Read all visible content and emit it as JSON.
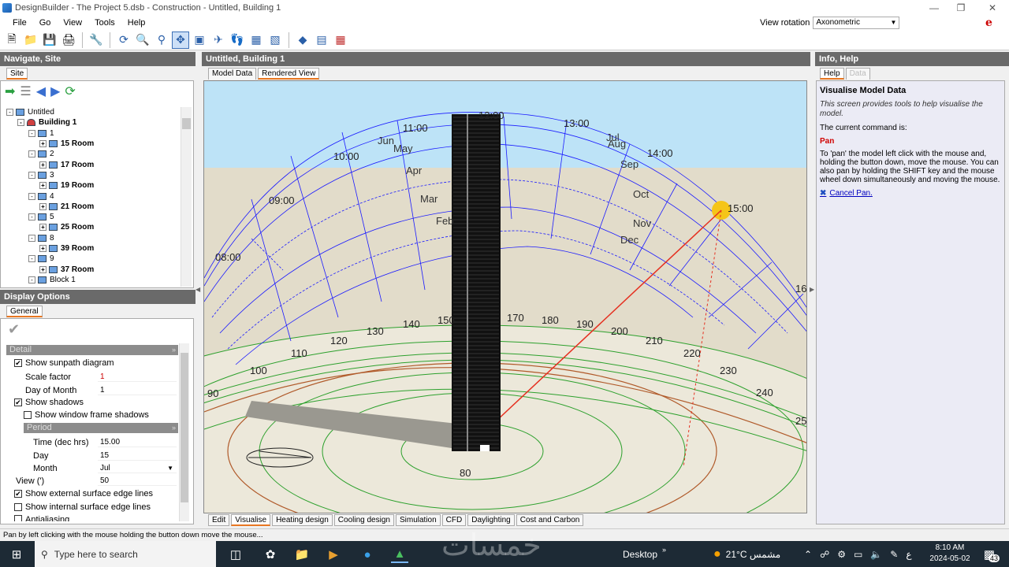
{
  "app": {
    "title": "DesignBuilder - The Project 5.dsb - Construction - Untitled, Building 1"
  },
  "menu": [
    "File",
    "Go",
    "View",
    "Tools",
    "Help"
  ],
  "view_rotation": {
    "label": "View rotation",
    "value": "Axonometric"
  },
  "left_panel": {
    "title": "Navigate, Site",
    "tab": "Site",
    "tree": [
      {
        "label": "Untitled",
        "level": 0,
        "bold": false,
        "icon": "site-icon"
      },
      {
        "label": "Building 1",
        "level": 1,
        "bold": true,
        "icon": "building-icon"
      },
      {
        "label": "1",
        "level": 2,
        "bold": false,
        "icon": "block-icon"
      },
      {
        "label": "15 Room",
        "level": 3,
        "bold": true,
        "icon": "zone-icon"
      },
      {
        "label": "2",
        "level": 2,
        "bold": false,
        "icon": "block-icon"
      },
      {
        "label": "17 Room",
        "level": 3,
        "bold": true,
        "icon": "zone-icon"
      },
      {
        "label": "3",
        "level": 2,
        "bold": false,
        "icon": "block-icon"
      },
      {
        "label": "19 Room",
        "level": 3,
        "bold": true,
        "icon": "zone-icon"
      },
      {
        "label": "4",
        "level": 2,
        "bold": false,
        "icon": "block-icon"
      },
      {
        "label": "21 Room",
        "level": 3,
        "bold": true,
        "icon": "zone-icon"
      },
      {
        "label": "5",
        "level": 2,
        "bold": false,
        "icon": "block-icon"
      },
      {
        "label": "25 Room",
        "level": 3,
        "bold": true,
        "icon": "zone-icon"
      },
      {
        "label": "8",
        "level": 2,
        "bold": false,
        "icon": "block-icon"
      },
      {
        "label": "39 Room",
        "level": 3,
        "bold": true,
        "icon": "zone-icon"
      },
      {
        "label": "9",
        "level": 2,
        "bold": false,
        "icon": "block-icon"
      },
      {
        "label": "37 Room",
        "level": 3,
        "bold": true,
        "icon": "zone-icon"
      },
      {
        "label": "Block 1",
        "level": 2,
        "bold": false,
        "icon": "block-icon"
      }
    ]
  },
  "display_options": {
    "title": "Display Options",
    "tab": "General",
    "detail_label": "Detail",
    "show_sunpath": "Show sunpath diagram",
    "scale_factor_label": "Scale factor",
    "scale_factor": "1",
    "day_of_month_label": "Day of Month",
    "day_of_month": "1",
    "show_shadows": "Show shadows",
    "show_window_frame_shadows": "Show window frame shadows",
    "period_label": "Period",
    "time_label": "Time (dec hrs)",
    "time": "15.00",
    "day_label": "Day",
    "day": "15",
    "month_label": "Month",
    "month": "Jul",
    "view_label": "View (')",
    "view": "50",
    "show_external_edges": "Show external surface edge lines",
    "show_internal_edges": "Show internal surface edge lines",
    "antialiasing": "Antialiasing"
  },
  "center": {
    "title": "Untitled, Building 1",
    "tabs": [
      "Model Data",
      "Rendered View"
    ],
    "bottom_tabs": [
      "Edit",
      "Visualise",
      "Heating design",
      "Cooling design",
      "Simulation",
      "CFD",
      "Daylighting",
      "Cost and Carbon"
    ],
    "hour_labels": [
      "11:00",
      "12:00",
      "13:00",
      "10:00",
      "14:00",
      "09:00",
      "15:00",
      "08:00",
      "16"
    ],
    "month_labels": [
      "Jun",
      "May",
      "Jul",
      "Aug",
      "Apr",
      "Sep",
      "Mar",
      "Oct",
      "Feb",
      "Nov",
      "Dec"
    ],
    "azimuth_labels": [
      "90",
      "100",
      "110",
      "120",
      "130",
      "140",
      "150",
      "170",
      "180",
      "190",
      "200",
      "210",
      "220",
      "230",
      "240",
      "25",
      "80"
    ]
  },
  "right_panel": {
    "title": "Info, Help",
    "tabs": [
      "Help",
      "Data"
    ],
    "heading": "Visualise Model Data",
    "intro": "This screen provides tools to help visualise the model.",
    "current_label": "The current command is:",
    "command": "Pan",
    "description": "To 'pan' the model left click with the mouse and, holding the button down, move the mouse. You can also pan by holding the SHIFT key and the mouse wheel down simultaneously and moving the mouse.",
    "cancel": "Cancel Pan."
  },
  "status": "Pan by left clicking with the mouse holding the button down move the mouse...",
  "taskbar": {
    "search_placeholder": "Type here to search",
    "desktop_label": "Desktop",
    "weather": "21°C  مشمس",
    "time": "8:10 AM",
    "date": "2024-05-02",
    "notifications": "43"
  },
  "watermark": "خمسات"
}
